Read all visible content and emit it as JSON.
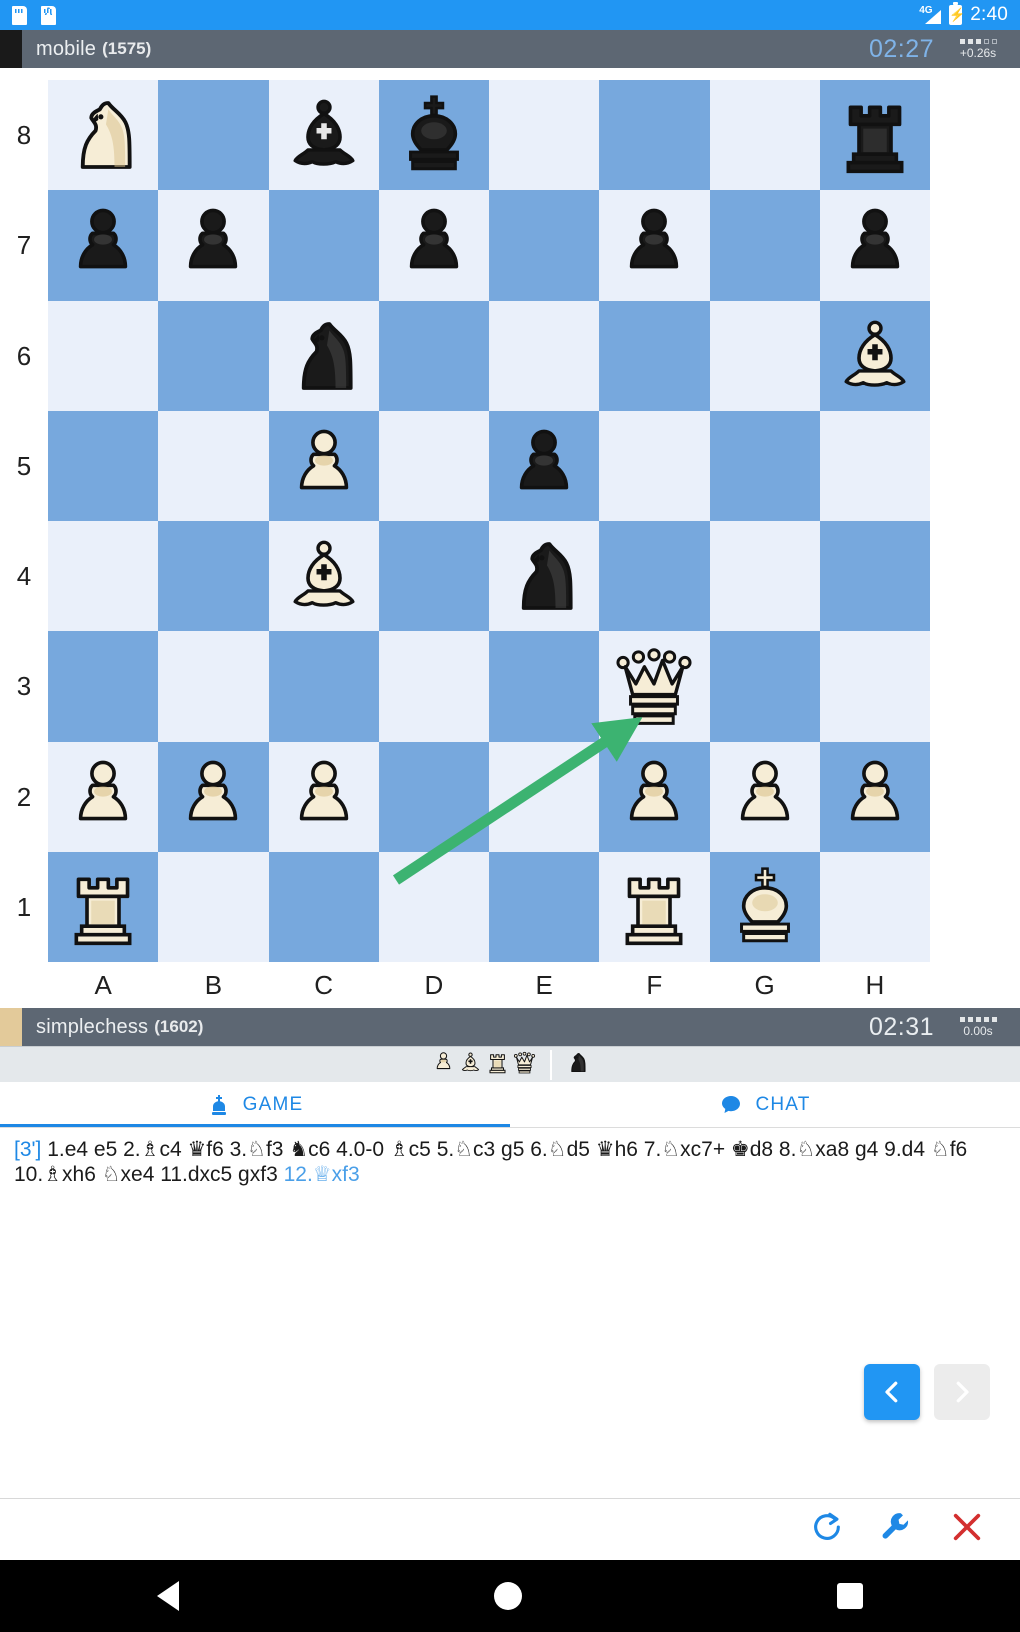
{
  "status_bar": {
    "icons": [
      "sdcard-icon",
      "sdcard-letter-icon"
    ],
    "sdcard_letter": "A",
    "network": "4G",
    "clock": "2:40"
  },
  "top_player": {
    "name": "mobile",
    "rating": "(1575)",
    "clock": "02:27",
    "lag": "+0.26s",
    "lag_dots_filled": 3,
    "lag_dots_total": 5,
    "accent_color": "#1a1a1a",
    "clock_color": "#7fb3e8"
  },
  "bottom_player": {
    "name": "simplechess",
    "rating": "(1602)",
    "clock": "02:31",
    "lag": "0.00s",
    "lag_dots_filled": 5,
    "lag_dots_total": 5,
    "accent_color": "#e3ca9a",
    "clock_color": "#e9edf0"
  },
  "board": {
    "light_square_color": "#eaf0fa",
    "dark_square_color": "#77a8dd",
    "files": [
      "A",
      "B",
      "C",
      "D",
      "E",
      "F",
      "G",
      "H"
    ],
    "ranks": [
      "8",
      "7",
      "6",
      "5",
      "4",
      "3",
      "2",
      "1"
    ],
    "orientation": "white-bottom",
    "pieces": [
      {
        "square": "a8",
        "piece": "white-knight"
      },
      {
        "square": "c8",
        "piece": "black-bishop"
      },
      {
        "square": "d8",
        "piece": "black-king"
      },
      {
        "square": "h8",
        "piece": "black-rook"
      },
      {
        "square": "a7",
        "piece": "black-pawn"
      },
      {
        "square": "b7",
        "piece": "black-pawn"
      },
      {
        "square": "d7",
        "piece": "black-pawn"
      },
      {
        "square": "f7",
        "piece": "black-pawn"
      },
      {
        "square": "h7",
        "piece": "black-pawn"
      },
      {
        "square": "c6",
        "piece": "black-knight"
      },
      {
        "square": "h6",
        "piece": "white-bishop"
      },
      {
        "square": "c5",
        "piece": "white-pawn"
      },
      {
        "square": "e5",
        "piece": "black-pawn"
      },
      {
        "square": "c4",
        "piece": "white-bishop"
      },
      {
        "square": "e4",
        "piece": "black-knight"
      },
      {
        "square": "f3",
        "piece": "white-queen"
      },
      {
        "square": "a2",
        "piece": "white-pawn"
      },
      {
        "square": "b2",
        "piece": "white-pawn"
      },
      {
        "square": "c2",
        "piece": "white-pawn"
      },
      {
        "square": "f2",
        "piece": "white-pawn"
      },
      {
        "square": "g2",
        "piece": "white-pawn"
      },
      {
        "square": "h2",
        "piece": "white-pawn"
      },
      {
        "square": "a1",
        "piece": "white-rook"
      },
      {
        "square": "f1",
        "piece": "white-rook"
      },
      {
        "square": "g1",
        "piece": "white-king"
      }
    ],
    "last_move_arrow": {
      "from": "d1",
      "to": "f3",
      "color": "#3cb371"
    }
  },
  "captured": {
    "by_black": [
      "white-pawn",
      "white-bishop",
      "white-rook",
      "white-queen"
    ],
    "by_white": [
      "black-knight"
    ]
  },
  "tabs": [
    {
      "label": "GAME",
      "icon": "king-icon",
      "active": true
    },
    {
      "label": "CHAT",
      "icon": "chat-bubble-icon",
      "active": false
    }
  ],
  "moves": {
    "clock_tag": "[3']",
    "line1": "1.e4 e5 2.♗c4 ♛f6 3.♘f3 ♞c6 4.0-0 ♗c5 5.♘c3 g5 6.♘d5 ♛h6 7.♘xc7+ ♚d8 8.♘xa8 g4 9.d4 ♘f6",
    "line2_plain": "10.♗xh6 ♘xe4 11.dxc5 gxf3 ",
    "line2_current": "12.♕xf3"
  },
  "nav": {
    "prev_label": "previous-move",
    "next_label": "next-move",
    "prev_enabled": true,
    "next_enabled": false,
    "prev_color": "#2196f3",
    "next_color": "#ececec"
  },
  "actions": [
    {
      "name": "rematch-icon",
      "color": "#1e88e5"
    },
    {
      "name": "wrench-icon",
      "color": "#1e88e5"
    },
    {
      "name": "close-icon",
      "color": "#d32f2f"
    }
  ],
  "android_nav": [
    "back-button",
    "home-button",
    "recents-button"
  ]
}
